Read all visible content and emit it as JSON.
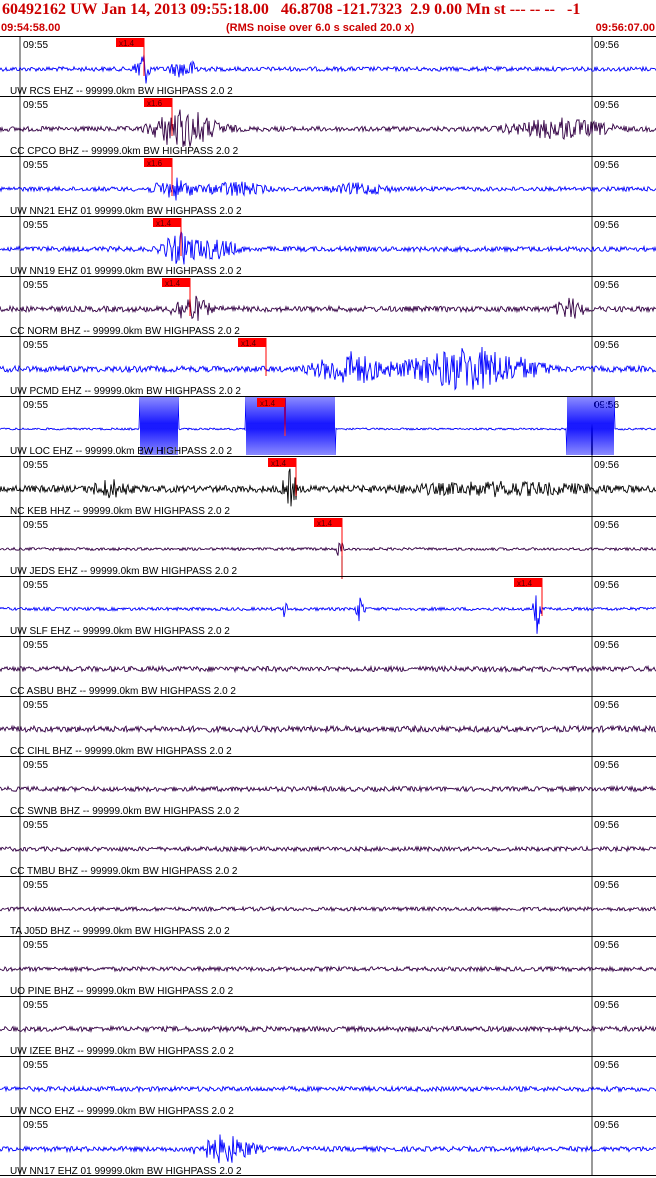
{
  "header": {
    "title": "60492162 UW Jan 14, 2013 09:55:18.00   46.8708 -121.7323  2.9 0.00 Mn st --- -- --   -1",
    "start_time": "09:54:58.00",
    "note": "(RMS noise over 6.0 s scaled 20.0 x)",
    "end_time": "09:56:07.00"
  },
  "time_ticks": [
    "09:55",
    "09:56"
  ],
  "colors": {
    "red": "#ff0000",
    "blue": "#0000ff",
    "purple": "#330044",
    "black": "#000000",
    "grid": "#000000"
  },
  "traces": [
    {
      "label": "UW RCS EHZ -- 99999.0km BW  HIGHPASS  2.0  2",
      "pick": "x1.4",
      "color": "blue"
    },
    {
      "label": "CC CPCO BHZ -- 99999.0km BW  HIGHPASS  2.0  2",
      "pick": "x1.6",
      "color": "purple"
    },
    {
      "label": "UW NN21 EHZ 01 99999.0km BW  HIGHPASS  2.0  2",
      "pick": "x1.6",
      "color": "blue"
    },
    {
      "label": "UW NN19 EHZ 01 99999.0km BW  HIGHPASS  2.0  2",
      "pick": "x1.4",
      "color": "blue"
    },
    {
      "label": "CC NORM BHZ -- 99999.0km BW  HIGHPASS  2.0  2",
      "pick": "x1.4",
      "color": "purple"
    },
    {
      "label": "UW PCMD EHZ -- 99999.0km BW  HIGHPASS  2.0  2",
      "pick": "x1.4",
      "color": "blue"
    },
    {
      "label": "UW LOC EHZ -- 99999.0km BW  HIGHPASS  2.0  2",
      "pick": "x1.4",
      "color": "blue"
    },
    {
      "label": "NC KEB HHZ -- 99999.0km BW  HIGHPASS  2.0  2",
      "pick": "x1.4",
      "color": "black"
    },
    {
      "label": "UW JEDS EHZ -- 99999.0km BW  HIGHPASS  2.0  2",
      "pick": "x1.4",
      "color": "purple"
    },
    {
      "label": "UW SLF EHZ -- 99999.0km BW  HIGHPASS  2.0  2",
      "pick": "x1.4",
      "color": "blue"
    },
    {
      "label": "CC ASBU BHZ -- 99999.0km BW  HIGHPASS  2.0  2",
      "pick": "",
      "color": "purple"
    },
    {
      "label": "CC CIHL BHZ -- 99999.0km BW  HIGHPASS  2.0  2",
      "pick": "",
      "color": "purple"
    },
    {
      "label": "CC SWNB BHZ -- 99999.0km BW  HIGHPASS  2.0  2",
      "pick": "",
      "color": "purple"
    },
    {
      "label": "CC TMBU BHZ -- 99999.0km BW  HIGHPASS  2.0  2",
      "pick": "",
      "color": "purple"
    },
    {
      "label": "TA J05D BHZ -- 99999.0km BW  HIGHPASS  2.0  2",
      "pick": "",
      "color": "purple"
    },
    {
      "label": "UO PINE BHZ -- 99999.0km BW  HIGHPASS  2.0  2",
      "pick": "",
      "color": "purple"
    },
    {
      "label": "UW IZEE BHZ -- 99999.0km BW  HIGHPASS  2.0  2",
      "pick": "",
      "color": "purple"
    },
    {
      "label": "UW NCO EHZ -- 99999.0km BW  HIGHPASS  2.0  2",
      "pick": "",
      "color": "blue"
    },
    {
      "label": "UW NN17 EHZ 01 99999.0km BW  HIGHPASS  2.0  2",
      "pick": "",
      "color": "blue"
    }
  ]
}
